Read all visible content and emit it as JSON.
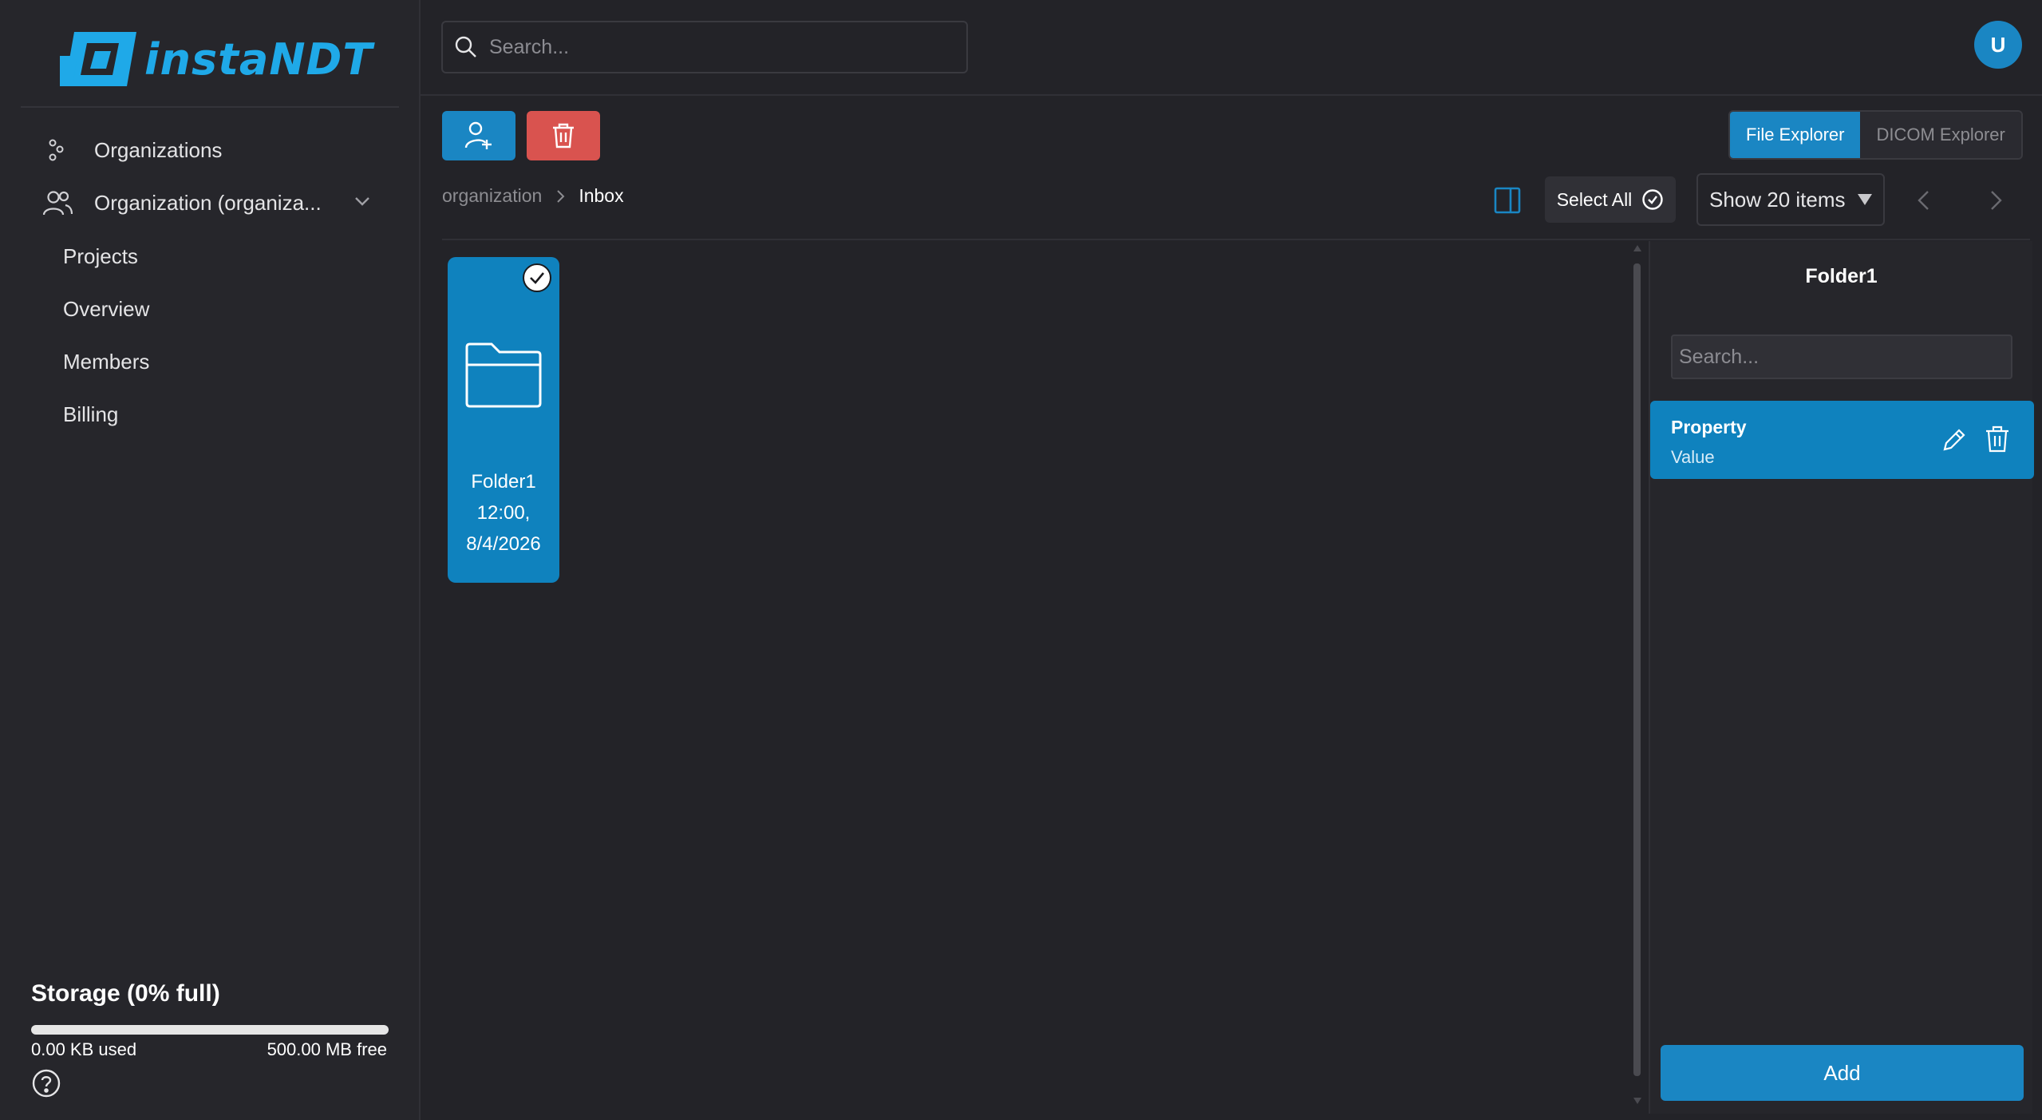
{
  "brand": {
    "name": "instaNDT"
  },
  "header": {
    "search_placeholder": "Search...",
    "avatar_initial": "U"
  },
  "sidebar": {
    "items": [
      {
        "label": "Organizations",
        "icon": "organizations-icon"
      },
      {
        "label": "Organization (organiza...",
        "icon": "users-icon"
      }
    ],
    "subitems": [
      {
        "label": "Projects"
      },
      {
        "label": "Overview"
      },
      {
        "label": "Members"
      },
      {
        "label": "Billing"
      }
    ],
    "storage": {
      "title": "Storage (0% full)",
      "used": "0.00 KB used",
      "free": "500.00 MB free",
      "percent_full": 0
    }
  },
  "toolbar": {
    "view_tabs": [
      {
        "label": "File Explorer",
        "active": true
      },
      {
        "label": "DICOM Explorer",
        "active": false
      }
    ],
    "select_all_label": "Select All",
    "show_items_label": "Show 20 items"
  },
  "breadcrumb": {
    "items": [
      "organization",
      "Inbox"
    ]
  },
  "grid": {
    "items": [
      {
        "name": "Folder1",
        "time": "12:00,",
        "date": "8/4/2026",
        "selected": true
      }
    ]
  },
  "details_panel": {
    "title": "Folder1",
    "search_placeholder": "Search...",
    "properties": [
      {
        "name": "Property",
        "value": "Value"
      }
    ],
    "add_label": "Add"
  },
  "colors": {
    "accent": "#1a86c3",
    "danger": "#d9534f",
    "background": "#232328",
    "sidebar": "#26262b"
  }
}
